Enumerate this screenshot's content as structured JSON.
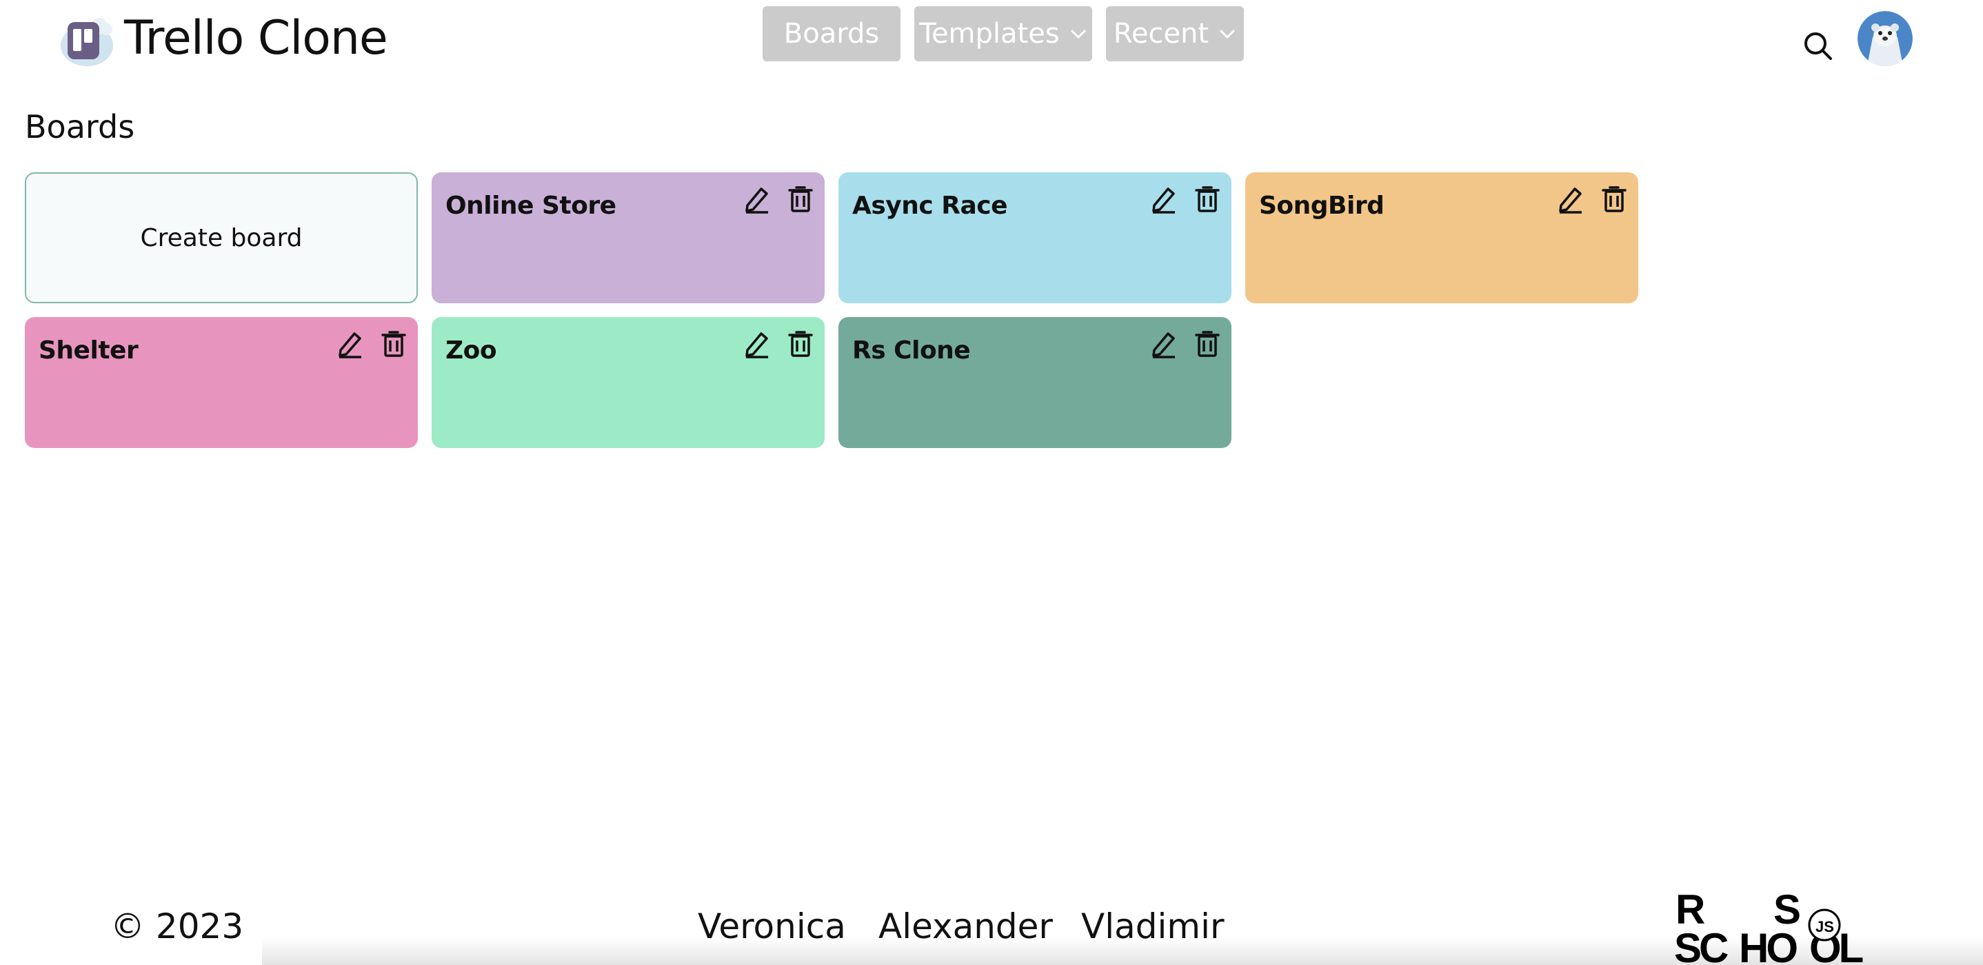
{
  "app": {
    "title": "Trello Clone"
  },
  "nav": {
    "boards": "Boards",
    "templates": "Templates",
    "recent": "Recent"
  },
  "section": {
    "title": "Boards"
  },
  "create_board_label": "Create board",
  "boards": [
    {
      "name": "Online Store",
      "color": "#c9b0d6"
    },
    {
      "name": "Async Race",
      "color": "#a8deeb"
    },
    {
      "name": "SongBird",
      "color": "#f2c689"
    },
    {
      "name": "Shelter",
      "color": "#e795be"
    },
    {
      "name": "Zoo",
      "color": "#9debc6"
    },
    {
      "name": "Rs Clone",
      "color": "#74aa9a"
    }
  ],
  "footer": {
    "copyright": "© 2023",
    "authors": [
      "Veronica",
      "Alexander",
      "Vladimir"
    ],
    "school_logo": "RS SCHOOL JS"
  },
  "icons": {
    "search": "search-icon",
    "edit": "pencil-icon",
    "delete": "trash-icon",
    "chevron": "chevron-down-icon"
  }
}
